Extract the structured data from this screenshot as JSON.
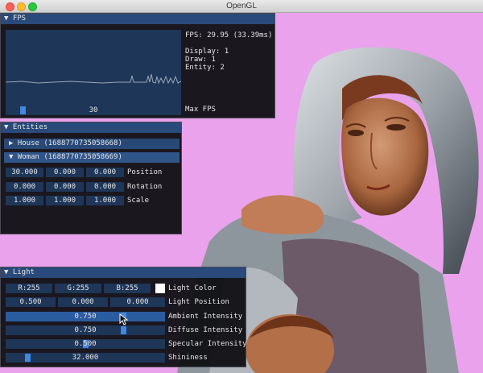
{
  "window": {
    "title": "OpenGL"
  },
  "fps_panel": {
    "title": "▼ FPS",
    "fps_text": "FPS: 29.95 (33.39ms)",
    "display": "Display: 1",
    "draw": "Draw: 1",
    "entity": "Entity: 2",
    "max_fps_value": "30",
    "max_fps_fraction": 0.08,
    "max_fps_label": "Max FPS"
  },
  "entities_panel": {
    "title": "▼ Entities",
    "house": "▶ House (1688770735058668)",
    "woman": "▼ Woman (1688770735058669)",
    "position": {
      "x": "30.000",
      "y": "0.000",
      "z": "0.000",
      "label": "Position"
    },
    "rotation": {
      "x": "0.000",
      "y": "0.000",
      "z": "0.000",
      "label": "Rotation"
    },
    "scale": {
      "x": "1.000",
      "y": "1.000",
      "z": "1.000",
      "label": "Scale"
    }
  },
  "light_panel": {
    "title": "▼ Light",
    "color": {
      "r": "R:255",
      "g": "G:255",
      "b": "B:255",
      "label": "Light Color",
      "swatch": "#ffffff"
    },
    "position": {
      "x": "0.500",
      "y": "0.000",
      "z": "0.000",
      "label": "Light Position"
    },
    "ambient": {
      "value": "0.750",
      "label": "Ambient Intensity",
      "fraction": 0.75
    },
    "diffuse": {
      "value": "0.750",
      "label": "Diffuse Intensity",
      "fraction": 0.75
    },
    "specular": {
      "value": "0.500",
      "label": "Specular Intensity",
      "fraction": 0.5
    },
    "shininess": {
      "value": "32.000",
      "label": "Shininess",
      "fraction": 0.12
    }
  },
  "colors": {
    "background": "#eaa2ec",
    "accent": "#4287e0",
    "frame": "#1e3658",
    "title_bar": "#294a7a"
  }
}
